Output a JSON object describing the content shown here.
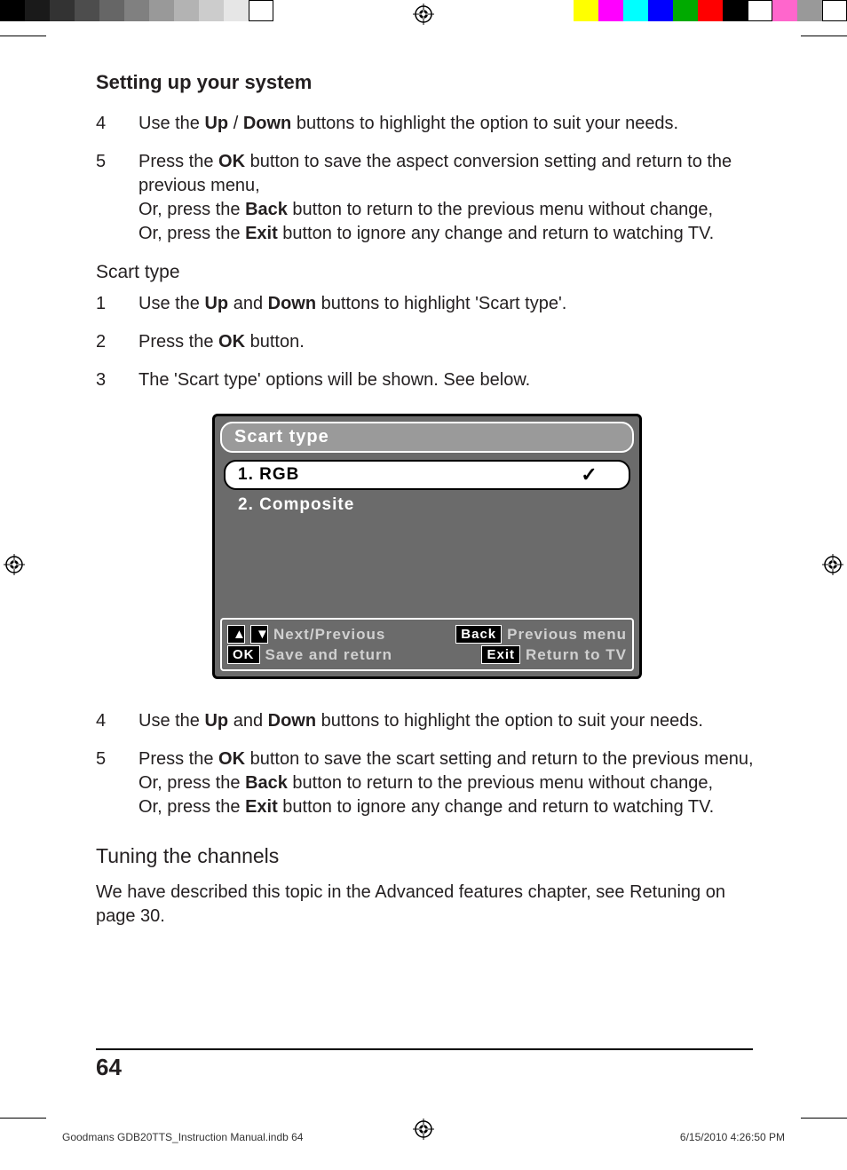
{
  "section_title": "Setting up your system",
  "steps_a": [
    {
      "n": "4",
      "parts": [
        "Use the ",
        "Up",
        " / ",
        "Down",
        " buttons to highlight the option to suit your needs."
      ]
    },
    {
      "n": "5",
      "parts": [
        "Press the ",
        "OK",
        " button to save the aspect conversion setting and return to the previous menu,",
        "Or, press the ",
        "Back",
        " button to return to the previous menu without change,",
        "Or, press the ",
        "Exit",
        " button to ignore any change and return to watching TV."
      ]
    }
  ],
  "scart_heading": "Scart type",
  "steps_b": [
    {
      "n": "1",
      "parts": [
        "Use the ",
        "Up",
        " and ",
        "Down",
        " buttons to highlight 'Scart type'."
      ]
    },
    {
      "n": "2",
      "parts": [
        "Press the ",
        "OK",
        " button."
      ]
    },
    {
      "n": "3",
      "parts": [
        "The 'Scart type' options will be shown. See below."
      ]
    }
  ],
  "osd": {
    "title": "Scart type",
    "options": [
      {
        "label": "1. RGB",
        "selected": true
      },
      {
        "label": "2. Composite",
        "selected": false
      }
    ],
    "footer": {
      "up_down": "Next/Previous",
      "ok": "Save and return",
      "back_key": "Back",
      "back_label": "Previous menu",
      "exit_key": "Exit",
      "exit_label": "Return to TV",
      "ok_key": "OK"
    }
  },
  "steps_c": [
    {
      "n": "4",
      "parts": [
        "Use the ",
        "Up",
        " and ",
        "Down",
        " buttons to highlight the option to suit your needs."
      ]
    },
    {
      "n": "5",
      "parts": [
        "Press the ",
        "OK",
        " button to save the scart setting and return to the previous menu,",
        "Or, press the ",
        "Back",
        " button to return to the previous menu without change,",
        "Or, press the ",
        "Exit",
        " button to ignore any change and return to watching TV."
      ]
    }
  ],
  "tuning_heading": "Tuning the channels",
  "tuning_para": "We have described this topic in the Advanced features chapter, see Retuning on page 30.",
  "page_number": "64",
  "footer_left": "Goodmans GDB20TTS_Instruction Manual.indb   64",
  "footer_right": "6/15/2010   4:26:50 PM"
}
